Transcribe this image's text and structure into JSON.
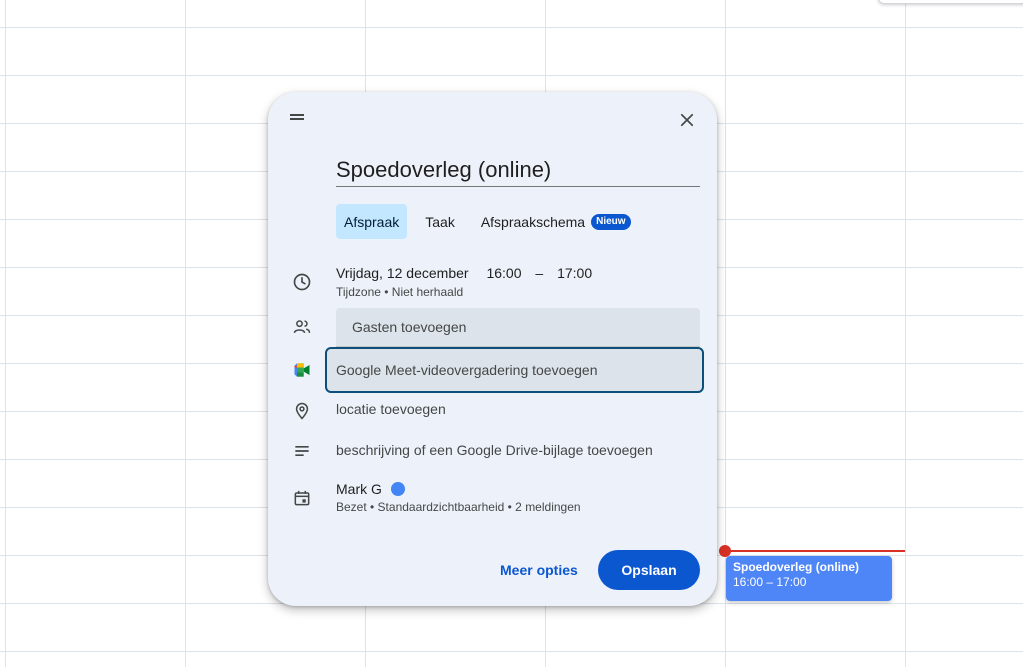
{
  "dialog": {
    "title_value": "Spoedoverleg (online)",
    "tabs": [
      {
        "label": "Afspraak",
        "active": true
      },
      {
        "label": "Taak",
        "active": false
      },
      {
        "label": "Afspraakschema",
        "active": false,
        "badge": "Nieuw"
      }
    ],
    "date": "Vrijdag, 12 december",
    "start_time": "16:00",
    "time_separator": "–",
    "end_time": "17:00",
    "timezone_line": "Tijdzone • Niet herhaald",
    "guests_placeholder": "Gasten toevoegen",
    "meet_label": "Google Meet-videovergadering toevoegen",
    "location_label": "locatie toevoegen",
    "description_label": "beschrijving of een Google Drive-bijlage toevoegen",
    "owner_name": "Mark G",
    "owner_color": "#4285f4",
    "owner_details": "Bezet • Standaardzichtbaarheid • 2 meldingen",
    "more_options_label": "Meer opties",
    "save_label": "Opslaan"
  },
  "event_chip": {
    "title": "Spoedoverleg (online)",
    "time": "16:00 – 17:00",
    "color": "#4f86f7"
  },
  "icons": {
    "drag": "drag-handle-icon",
    "close": "close-icon",
    "time": "clock-icon",
    "guests": "people-icon",
    "meet": "google-meet-icon",
    "location": "location-pin-icon",
    "description": "notes-icon",
    "calendar": "calendar-icon"
  },
  "colors": {
    "accent": "#0b57d0",
    "dialog_bg": "#edf2fa",
    "active_tab": "#c2e7ff",
    "now_indicator": "#d93025"
  }
}
